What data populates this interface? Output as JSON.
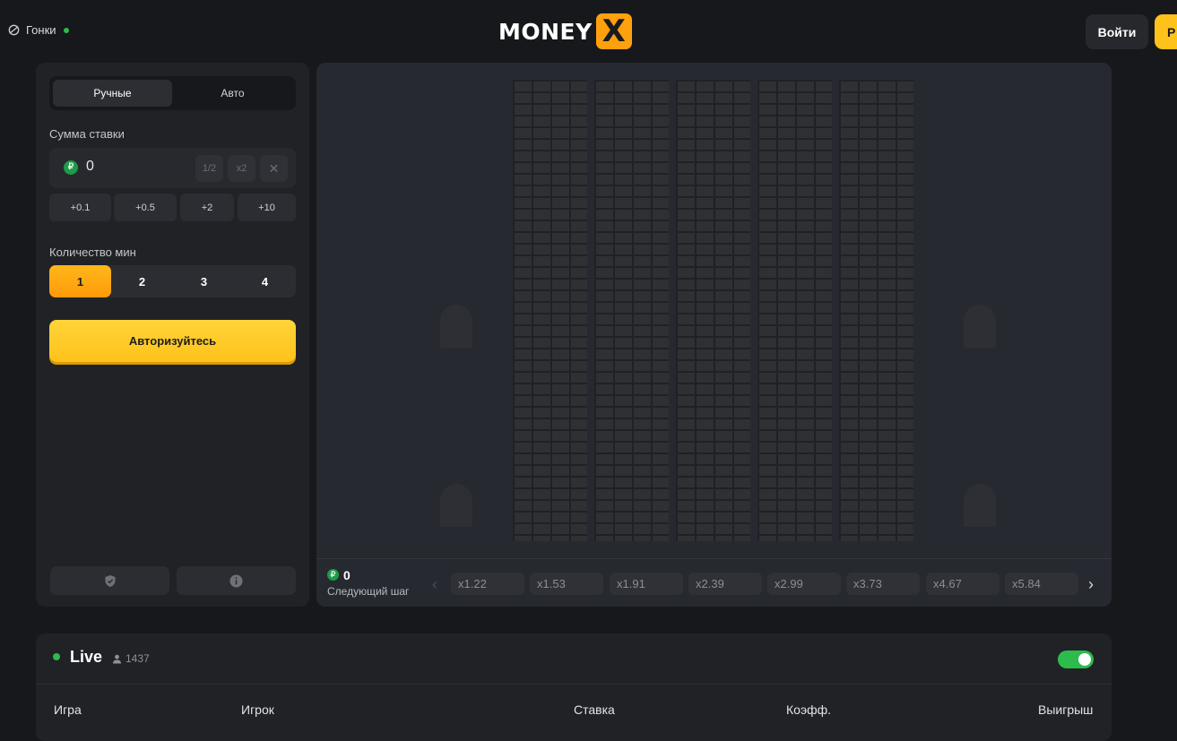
{
  "header": {
    "races_label": "Гонки",
    "logo_text": "MONEY",
    "logo_x": "X",
    "login_label": "Войти",
    "register_label": "Р"
  },
  "bet_panel": {
    "tabs": {
      "manual": "Ручные",
      "auto": "Авто"
    },
    "amount_label": "Сумма ставки",
    "currency_symbol": "₽",
    "amount_value": "0",
    "half_label": "1/2",
    "double_label": "x2",
    "clear_label": "✕",
    "quick_adds": [
      "+0.1",
      "+0.5",
      "+2",
      "+10"
    ],
    "mines_label": "Количество мин",
    "mines_options": [
      "1",
      "2",
      "3",
      "4"
    ],
    "mines_selected": "1",
    "auth_label": "Авторизуйтесь"
  },
  "game": {
    "next_step_amount": "0",
    "next_step_label": "Следующий шаг",
    "prev_arrow": "‹",
    "next_arrow": "›",
    "multipliers": [
      "x1.22",
      "x1.53",
      "x1.91",
      "x2.39",
      "x2.99",
      "x3.73",
      "x4.67",
      "x5.84"
    ]
  },
  "live": {
    "title": "Live",
    "online_count": "1437",
    "toggle_on": true,
    "columns": [
      "Игра",
      "Игрок",
      "Ставка",
      "Коэфф.",
      "Выигрыш"
    ]
  },
  "colors": {
    "accent": "#ffc21a",
    "accent_orange": "#ffa10e",
    "success": "#2dbb4c",
    "background": "#17181b",
    "panel": "#202226"
  }
}
